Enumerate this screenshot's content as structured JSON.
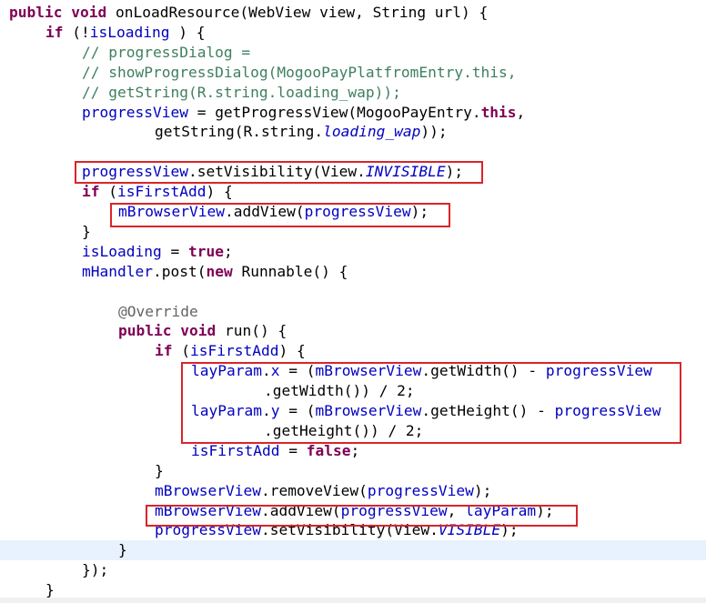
{
  "editor": {
    "language": "java",
    "current_line_index": 27,
    "colors": {
      "keyword": "#7f0055",
      "comment": "#3f7f5f",
      "field": "#0000c0",
      "annotation": "#646464",
      "highlight_box": "#d9252a",
      "current_line": "#e8f2fe"
    },
    "lines": [
      {
        "indent": 0,
        "tokens": [
          [
            "kw",
            "public"
          ],
          [
            "",
            "·"
          ],
          [
            "kw",
            "void"
          ],
          [
            "",
            " onLoadResource(WebView view, String url) {"
          ]
        ]
      },
      {
        "indent": 4,
        "tokens": [
          [
            "kw",
            "if"
          ],
          [
            "",
            " (!"
          ],
          [
            "fld",
            "isLoading"
          ],
          [
            "",
            " ) {"
          ]
        ]
      },
      {
        "indent": 8,
        "tokens": [
          [
            "cm",
            "// progressDialog ="
          ]
        ]
      },
      {
        "indent": 8,
        "tokens": [
          [
            "cm",
            "// showProgressDialog(MogooPayPlatfromEntry.this,"
          ]
        ]
      },
      {
        "indent": 8,
        "tokens": [
          [
            "cm",
            "// getString(R.string.loading_wap));"
          ]
        ]
      },
      {
        "indent": 8,
        "tokens": [
          [
            "fld",
            "progressView"
          ],
          [
            "",
            " = getProgressView(MogooPayEntry."
          ],
          [
            "kw",
            "this"
          ],
          [
            "",
            ","
          ]
        ]
      },
      {
        "indent": 16,
        "tokens": [
          [
            "",
            "getString(R.string."
          ],
          [
            "fld ital",
            "loading_wap"
          ],
          [
            "",
            "));"
          ]
        ]
      },
      {
        "indent": 0,
        "tokens": []
      },
      {
        "indent": 8,
        "tokens": [
          [
            "fld",
            "progressView"
          ],
          [
            "",
            ".setVisibility(View."
          ],
          [
            "fld ital",
            "INVISIBLE"
          ],
          [
            "",
            ");"
          ]
        ]
      },
      {
        "indent": 8,
        "tokens": [
          [
            "kw",
            "if"
          ],
          [
            "",
            " ("
          ],
          [
            "fld",
            "isFirstAdd"
          ],
          [
            "",
            ") {"
          ]
        ]
      },
      {
        "indent": 12,
        "tokens": [
          [
            "fld",
            "mBrowserView"
          ],
          [
            "",
            ".addView("
          ],
          [
            "fld",
            "progressView"
          ],
          [
            "",
            ");"
          ]
        ]
      },
      {
        "indent": 8,
        "tokens": [
          [
            "",
            "}"
          ]
        ]
      },
      {
        "indent": 8,
        "tokens": [
          [
            "fld",
            "isLoading"
          ],
          [
            "",
            " = "
          ],
          [
            "kw",
            "true"
          ],
          [
            "",
            ";"
          ]
        ]
      },
      {
        "indent": 8,
        "tokens": [
          [
            "fld",
            "mHandler"
          ],
          [
            "",
            ".post("
          ],
          [
            "kw",
            "new"
          ],
          [
            "",
            " Runnable() {"
          ]
        ]
      },
      {
        "indent": 0,
        "tokens": []
      },
      {
        "indent": 12,
        "tokens": [
          [
            "ann",
            "@Override"
          ]
        ]
      },
      {
        "indent": 12,
        "tokens": [
          [
            "kw",
            "public"
          ],
          [
            "",
            " "
          ],
          [
            "kw",
            "void"
          ],
          [
            "",
            " run() {"
          ]
        ]
      },
      {
        "indent": 16,
        "tokens": [
          [
            "kw",
            "if"
          ],
          [
            "",
            " ("
          ],
          [
            "fld",
            "isFirstAdd"
          ],
          [
            "",
            ") {"
          ]
        ]
      },
      {
        "indent": 20,
        "tokens": [
          [
            "fld",
            "layParam"
          ],
          [
            "",
            "."
          ],
          [
            "fld",
            "x"
          ],
          [
            "",
            " = ("
          ],
          [
            "fld",
            "mBrowserView"
          ],
          [
            "",
            ".getWidth() - "
          ],
          [
            "fld",
            "progressView"
          ]
        ]
      },
      {
        "indent": 28,
        "tokens": [
          [
            "",
            ".getWidth()) / 2;"
          ]
        ]
      },
      {
        "indent": 20,
        "tokens": [
          [
            "fld",
            "layParam"
          ],
          [
            "",
            "."
          ],
          [
            "fld",
            "y"
          ],
          [
            "",
            " = ("
          ],
          [
            "fld",
            "mBrowserView"
          ],
          [
            "",
            ".getHeight() - "
          ],
          [
            "fld",
            "progressView"
          ]
        ]
      },
      {
        "indent": 28,
        "tokens": [
          [
            "",
            ".getHeight()) / 2;"
          ]
        ]
      },
      {
        "indent": 20,
        "tokens": [
          [
            "fld",
            "isFirstAdd"
          ],
          [
            "",
            " = "
          ],
          [
            "kw",
            "false"
          ],
          [
            "",
            ";"
          ]
        ]
      },
      {
        "indent": 16,
        "tokens": [
          [
            "",
            "}"
          ]
        ]
      },
      {
        "indent": 16,
        "tokens": [
          [
            "fld",
            "mBrowserView"
          ],
          [
            "",
            ".removeView("
          ],
          [
            "fld",
            "progressView"
          ],
          [
            "",
            ");"
          ]
        ]
      },
      {
        "indent": 16,
        "tokens": [
          [
            "fld",
            "mBrowserView"
          ],
          [
            "",
            ".addView("
          ],
          [
            "fld",
            "progressView"
          ],
          [
            "",
            ", "
          ],
          [
            "fld",
            "layParam"
          ],
          [
            "",
            ");"
          ]
        ]
      },
      {
        "indent": 16,
        "tokens": [
          [
            "fld",
            "progressView"
          ],
          [
            "",
            ".setVisibility(View."
          ],
          [
            "fld ital",
            "VISIBLE"
          ],
          [
            "",
            ");"
          ]
        ]
      },
      {
        "indent": 12,
        "tokens": [
          [
            "",
            "}"
          ]
        ]
      },
      {
        "indent": 8,
        "tokens": [
          [
            "",
            "});"
          ]
        ]
      },
      {
        "indent": 4,
        "tokens": [
          [
            "",
            "}"
          ]
        ]
      }
    ]
  }
}
